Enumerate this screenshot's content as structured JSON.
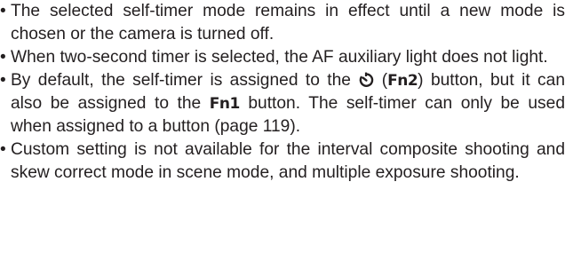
{
  "notes": {
    "bullet": "•",
    "items": [
      {
        "text": "The selected self-timer mode remains in effect until a new mode is chosen or the camera is turned off."
      },
      {
        "text": "When two-second timer is selected, the AF auxiliary light does not light."
      },
      {
        "before_icon": "By default, the self-timer is assigned to the ",
        "open_paren": " (",
        "fn2": "Fn2",
        "after_fn2": ") button, but it can also be assigned to the ",
        "fn1": "Fn1",
        "after_fn1": " button. The self-timer can only be used when assigned to a button (page 119).",
        "icon": "self-timer-icon"
      },
      {
        "text": "Custom setting is not available for the interval composite shooting and skew correct mode in scene mode, and multiple exposure shooting."
      }
    ]
  }
}
